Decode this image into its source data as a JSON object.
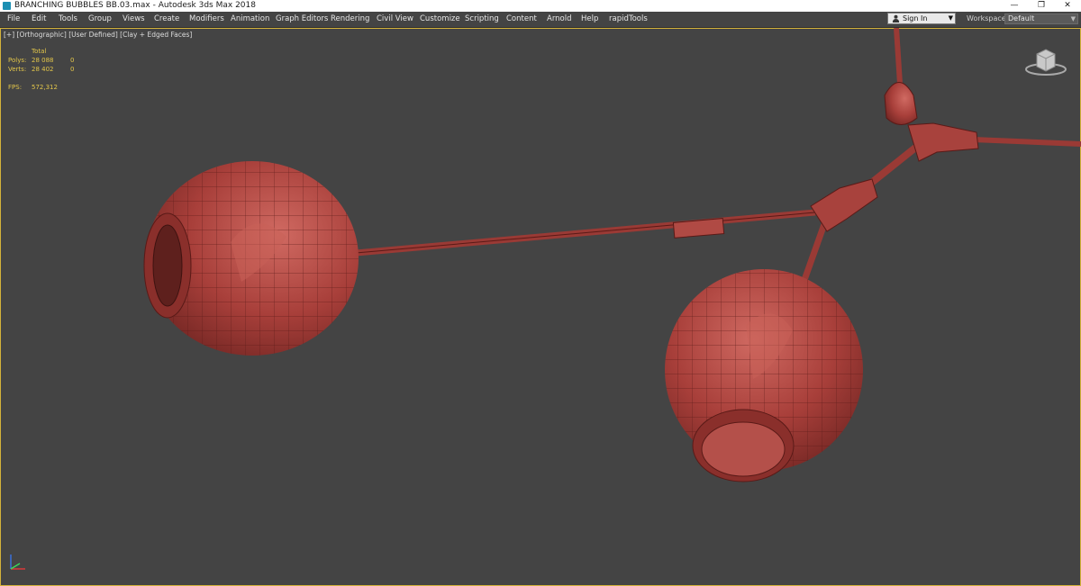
{
  "window": {
    "title": "BRANCHING BUBBLES BB.03.max - Autodesk 3ds Max 2018",
    "minimize": "—",
    "maximize": "❐",
    "close": "✕"
  },
  "menu": [
    "File",
    "Edit",
    "Tools",
    "Group",
    "Views",
    "Create",
    "Modifiers",
    "Animation",
    "Graph Editors",
    "Rendering",
    "Civil View",
    "Customize",
    "Scripting",
    "Content",
    "Arnold",
    "Help",
    "rapidTools"
  ],
  "account": {
    "sign_in": "Sign In"
  },
  "workspaces": {
    "label": "Workspaces:",
    "value": "Default"
  },
  "viewport": {
    "label": "[+] [Orthographic] [User Defined] [Clay + Edged Faces]",
    "stats": {
      "header": "Total",
      "polys_label": "Polys:",
      "polys_total": "28 088",
      "polys_sel": "0",
      "verts_label": "Verts:",
      "verts_total": "28 402",
      "verts_sel": "0",
      "fps_label": "FPS:",
      "fps_value": "572,312"
    }
  },
  "colors": {
    "accent_border": "#d4b23a",
    "stats_text": "#e3c64a",
    "viewport_bg": "#444444",
    "clay": "#b0443f"
  },
  "icons": {
    "app": "3ds-max-icon",
    "viewcube": "viewcube-icon",
    "axis": "world-axis-tripod-icon",
    "account": "user-icon"
  }
}
